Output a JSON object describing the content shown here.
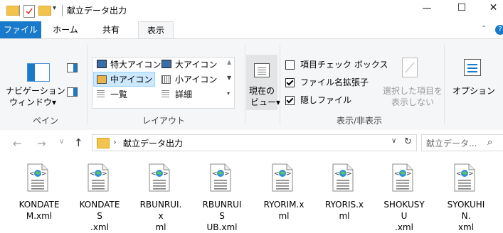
{
  "window": {
    "title": "献立データ出力",
    "controls": {
      "minimize": "—",
      "maximize": "☐",
      "close": "✕"
    }
  },
  "tabs": {
    "file": "ファイル",
    "home": "ホーム",
    "share": "共有",
    "view": "表示"
  },
  "ribbon": {
    "pane": {
      "nav_pane_line1": "ナビゲーション",
      "nav_pane_line2": "ウィンドウ▾",
      "group_label": "ペイン"
    },
    "layout": {
      "items": {
        "extra_large": "特大アイコン",
        "large": "大アイコン",
        "medium": "中アイコン",
        "small": "小アイコン",
        "list": "一覧",
        "details": "詳細"
      },
      "group_label": "レイアウト"
    },
    "current_view": {
      "line1": "現在の",
      "line2": "ビュー▾"
    },
    "show_hide": {
      "item_checkboxes": "項目チェック ボックス",
      "file_extensions": "ファイル名拡張子",
      "hidden_files": "隠しファイル",
      "hide_selected_line1": "選択した項目を",
      "hide_selected_line2": "表示しない",
      "group_label": "表示/非表示"
    },
    "options": "オプション"
  },
  "address": {
    "path_sep": "›",
    "path": "献立データ出力",
    "search_placeholder": "献立データ..."
  },
  "files": [
    {
      "line1": "KONDATE",
      "line2": "M.xml"
    },
    {
      "line1": "KONDATES",
      "line2": ".xml"
    },
    {
      "line1": "RBUNRUI.x",
      "line2": "ml"
    },
    {
      "line1": "RBUNRUIS",
      "line2": "UB.xml"
    },
    {
      "line1": "RYORIM.x",
      "line2": "ml"
    },
    {
      "line1": "RYORIS.xml",
      "line2": ""
    },
    {
      "line1": "SHOKUSYU",
      "line2": ".xml"
    },
    {
      "line1": "SYOKUHIN.",
      "line2": "xml"
    }
  ],
  "colors": {
    "accent": "#1979ca",
    "folder": "#f3c44d",
    "selection": "#cce8ff",
    "ribbon_bg": "#f5f6f7"
  }
}
